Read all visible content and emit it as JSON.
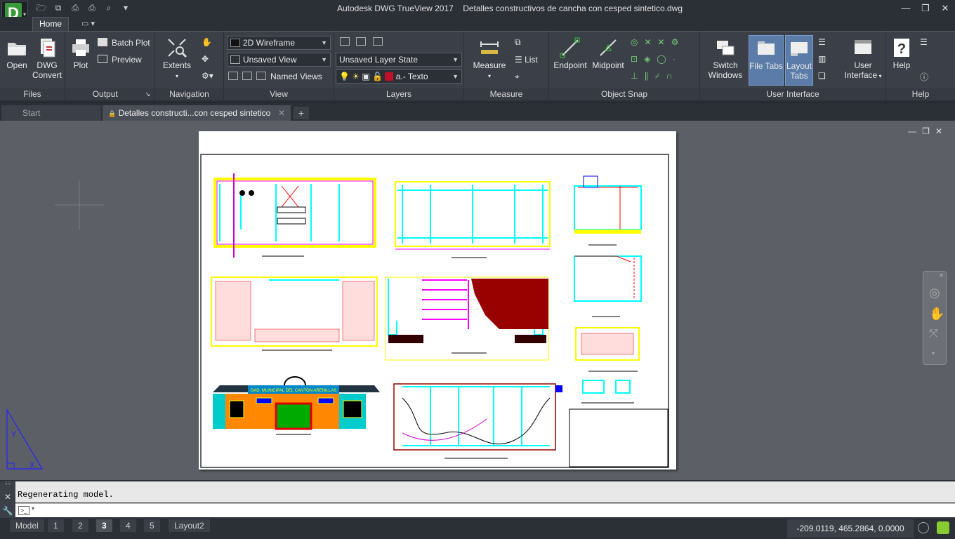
{
  "titlebar": {
    "app_title": "Autodesk DWG TrueView 2017",
    "file_name": "Detalles constructivos de cancha con cesped sintetico.dwg",
    "logo_letter": "D"
  },
  "ribbon_tabs": {
    "home": "Home"
  },
  "ribbon": {
    "files": {
      "label": "Files",
      "open": "Open",
      "dwg_convert_1": "DWG",
      "dwg_convert_2": "Convert"
    },
    "output": {
      "label": "Output",
      "plot": "Plot",
      "batch_plot": "Batch Plot",
      "preview": "Preview"
    },
    "navigation": {
      "label": "Navigation",
      "extents": "Extents"
    },
    "view": {
      "label": "View",
      "visual_style": "2D Wireframe",
      "saved_view": "Unsaved View",
      "named_views": "Named Views"
    },
    "layers": {
      "label": "Layers",
      "layer_state": "Unsaved Layer State",
      "current_layer": "a.- Texto",
      "layer_color": "#c0102a"
    },
    "measure": {
      "label": "Measure",
      "measure": "Measure",
      "list": "List"
    },
    "object_snap": {
      "label": "Object Snap",
      "endpoint": "Endpoint",
      "midpoint": "Midpoint"
    },
    "user_interface": {
      "label": "User Interface",
      "switch_1": "Switch",
      "switch_2": "Windows",
      "file_tabs": "File Tabs",
      "layout_1": "Layout",
      "layout_2": "Tabs",
      "ui_1": "User",
      "ui_2": "Interface"
    },
    "help": {
      "label": "Help",
      "help": "Help"
    }
  },
  "doc_tabs": {
    "start": "Start",
    "active": "Detalles constructi...con cesped sintetico"
  },
  "drawing": {
    "facade_sign": "GAD. MUNICIPAL DEL CANTÓN ARENILLAS"
  },
  "command": {
    "history": "Regenerating model."
  },
  "layout_tabs": [
    "Model",
    "1",
    "2",
    "3",
    "4",
    "5",
    "Layout2"
  ],
  "active_layout": "3",
  "coordinates": "-209.0119, 465.2864, 0.0000",
  "colors": {
    "accent_blue": "#5b7ca8",
    "dark_bg": "#2b2f36",
    "ribbon_bg": "#3b4048"
  }
}
